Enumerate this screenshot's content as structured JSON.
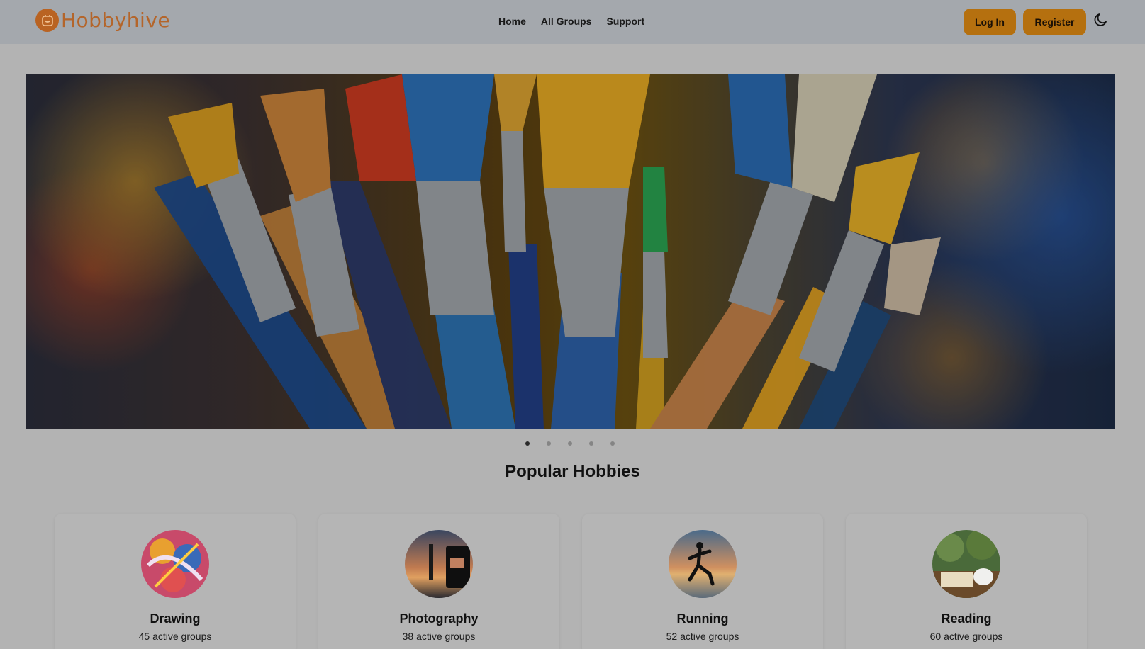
{
  "header": {
    "brand": "Hobbyhive",
    "nav": [
      {
        "label": "Home"
      },
      {
        "label": "All Groups"
      },
      {
        "label": "Support"
      }
    ],
    "login_label": "Log In",
    "register_label": "Register",
    "theme_icon": "moon-icon"
  },
  "hero": {
    "slide_count": 5,
    "active_slide": 1
  },
  "section": {
    "title": "Popular Hobbies"
  },
  "hobbies": [
    {
      "name": "Drawing",
      "groups": "45 active groups"
    },
    {
      "name": "Photography",
      "groups": "38 active groups"
    },
    {
      "name": "Running",
      "groups": "52 active groups"
    },
    {
      "name": "Reading",
      "groups": "60 active groups"
    }
  ],
  "colors": {
    "accent": "#b5700f",
    "brand": "#b4652a",
    "header_bg": "#a4a8ad",
    "page_bg": "#b3b3b3"
  }
}
